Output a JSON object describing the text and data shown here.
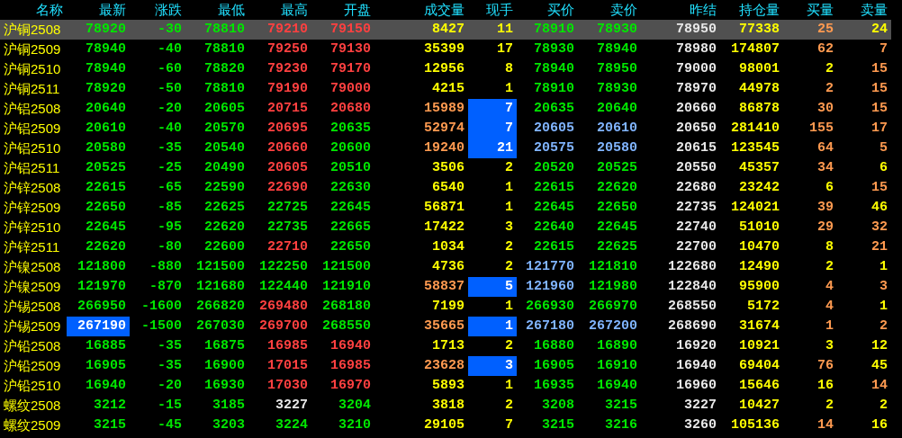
{
  "columns": [
    "名称",
    "最新",
    "涨跌",
    "最低",
    "最高",
    "开盘",
    "成交量",
    "现手",
    "买价",
    "卖价",
    "昨结",
    "持仓量",
    "买量",
    "卖量"
  ],
  "rows": [
    {
      "name": "沪铜2508",
      "selected": true,
      "cells": [
        {
          "text": "78920",
          "color": "#00e600",
          "highlighted": false
        },
        {
          "text": "-30",
          "color": "#00e600",
          "highlighted": false
        },
        {
          "text": "78810",
          "color": "#00e600",
          "highlighted": false
        },
        {
          "text": "79210",
          "color": "#ff4040",
          "highlighted": false
        },
        {
          "text": "79150",
          "color": "#ff4040",
          "highlighted": false
        },
        {
          "text": "8427",
          "color": "#ffff00",
          "highlighted": false
        },
        {
          "text": "11",
          "color": "#ffff00",
          "highlighted": false
        },
        {
          "text": "78910",
          "color": "#00e600",
          "highlighted": false
        },
        {
          "text": "78930",
          "color": "#00e600",
          "highlighted": false
        },
        {
          "text": "78950",
          "color": "#e8e8e8",
          "highlighted": false
        },
        {
          "text": "77338",
          "color": "#ffff00",
          "highlighted": false
        },
        {
          "text": "25",
          "color": "#ff9a50",
          "highlighted": false
        },
        {
          "text": "24",
          "color": "#ffff00",
          "highlighted": false
        }
      ]
    },
    {
      "name": "沪铜2509",
      "selected": false,
      "cells": [
        {
          "text": "78940",
          "color": "#00e600",
          "highlighted": false
        },
        {
          "text": "-40",
          "color": "#00e600",
          "highlighted": false
        },
        {
          "text": "78810",
          "color": "#00e600",
          "highlighted": false
        },
        {
          "text": "79250",
          "color": "#ff4040",
          "highlighted": false
        },
        {
          "text": "79130",
          "color": "#ff4040",
          "highlighted": false
        },
        {
          "text": "35399",
          "color": "#ffff00",
          "highlighted": false
        },
        {
          "text": "17",
          "color": "#ffff00",
          "highlighted": false
        },
        {
          "text": "78930",
          "color": "#00e600",
          "highlighted": false
        },
        {
          "text": "78940",
          "color": "#00e600",
          "highlighted": false
        },
        {
          "text": "78980",
          "color": "#e8e8e8",
          "highlighted": false
        },
        {
          "text": "174807",
          "color": "#ffff00",
          "highlighted": false
        },
        {
          "text": "62",
          "color": "#ff9a50",
          "highlighted": false
        },
        {
          "text": "7",
          "color": "#ff9a50",
          "highlighted": false
        }
      ]
    },
    {
      "name": "沪铜2510",
      "selected": false,
      "cells": [
        {
          "text": "78940",
          "color": "#00e600",
          "highlighted": false
        },
        {
          "text": "-60",
          "color": "#00e600",
          "highlighted": false
        },
        {
          "text": "78820",
          "color": "#00e600",
          "highlighted": false
        },
        {
          "text": "79230",
          "color": "#ff4040",
          "highlighted": false
        },
        {
          "text": "79170",
          "color": "#ff4040",
          "highlighted": false
        },
        {
          "text": "12956",
          "color": "#ffff00",
          "highlighted": false
        },
        {
          "text": "8",
          "color": "#ffff00",
          "highlighted": false
        },
        {
          "text": "78940",
          "color": "#00e600",
          "highlighted": false
        },
        {
          "text": "78950",
          "color": "#00e600",
          "highlighted": false
        },
        {
          "text": "79000",
          "color": "#e8e8e8",
          "highlighted": false
        },
        {
          "text": "98001",
          "color": "#ffff00",
          "highlighted": false
        },
        {
          "text": "2",
          "color": "#ffff00",
          "highlighted": false
        },
        {
          "text": "15",
          "color": "#ff9a50",
          "highlighted": false
        }
      ]
    },
    {
      "name": "沪铜2511",
      "selected": false,
      "cells": [
        {
          "text": "78920",
          "color": "#00e600",
          "highlighted": false
        },
        {
          "text": "-50",
          "color": "#00e600",
          "highlighted": false
        },
        {
          "text": "78810",
          "color": "#00e600",
          "highlighted": false
        },
        {
          "text": "79190",
          "color": "#ff4040",
          "highlighted": false
        },
        {
          "text": "79000",
          "color": "#ff4040",
          "highlighted": false
        },
        {
          "text": "4215",
          "color": "#ffff00",
          "highlighted": false
        },
        {
          "text": "1",
          "color": "#ffff00",
          "highlighted": false
        },
        {
          "text": "78910",
          "color": "#00e600",
          "highlighted": false
        },
        {
          "text": "78930",
          "color": "#00e600",
          "highlighted": false
        },
        {
          "text": "78970",
          "color": "#e8e8e8",
          "highlighted": false
        },
        {
          "text": "44978",
          "color": "#ffff00",
          "highlighted": false
        },
        {
          "text": "2",
          "color": "#ff9a50",
          "highlighted": false
        },
        {
          "text": "15",
          "color": "#ff9a50",
          "highlighted": false
        }
      ]
    },
    {
      "name": "沪铝2508",
      "selected": false,
      "cells": [
        {
          "text": "20640",
          "color": "#00e600",
          "highlighted": false
        },
        {
          "text": "-20",
          "color": "#00e600",
          "highlighted": false
        },
        {
          "text": "20605",
          "color": "#00e600",
          "highlighted": false
        },
        {
          "text": "20715",
          "color": "#ff4040",
          "highlighted": false
        },
        {
          "text": "20680",
          "color": "#ff4040",
          "highlighted": false
        },
        {
          "text": "15989",
          "color": "#ff9a50",
          "highlighted": false
        },
        {
          "text": "7",
          "color": "#ffffff",
          "highlighted": true
        },
        {
          "text": "20635",
          "color": "#00e600",
          "highlighted": false
        },
        {
          "text": "20640",
          "color": "#00e600",
          "highlighted": false
        },
        {
          "text": "20660",
          "color": "#e8e8e8",
          "highlighted": false
        },
        {
          "text": "86878",
          "color": "#ffff00",
          "highlighted": false
        },
        {
          "text": "30",
          "color": "#ff9a50",
          "highlighted": false
        },
        {
          "text": "15",
          "color": "#ff9a50",
          "highlighted": false
        }
      ]
    },
    {
      "name": "沪铝2509",
      "selected": false,
      "cells": [
        {
          "text": "20610",
          "color": "#00e600",
          "highlighted": false
        },
        {
          "text": "-40",
          "color": "#00e600",
          "highlighted": false
        },
        {
          "text": "20570",
          "color": "#00e600",
          "highlighted": false
        },
        {
          "text": "20695",
          "color": "#ff4040",
          "highlighted": false
        },
        {
          "text": "20635",
          "color": "#00e600",
          "highlighted": false
        },
        {
          "text": "52974",
          "color": "#ff9a50",
          "highlighted": false
        },
        {
          "text": "7",
          "color": "#ffffff",
          "highlighted": true
        },
        {
          "text": "20605",
          "color": "#80b4ff",
          "highlighted": false
        },
        {
          "text": "20610",
          "color": "#80b4ff",
          "highlighted": false
        },
        {
          "text": "20650",
          "color": "#e8e8e8",
          "highlighted": false
        },
        {
          "text": "281410",
          "color": "#ffff00",
          "highlighted": false
        },
        {
          "text": "155",
          "color": "#ff9a50",
          "highlighted": false
        },
        {
          "text": "17",
          "color": "#ff9a50",
          "highlighted": false
        }
      ]
    },
    {
      "name": "沪铝2510",
      "selected": false,
      "cells": [
        {
          "text": "20580",
          "color": "#00e600",
          "highlighted": false
        },
        {
          "text": "-35",
          "color": "#00e600",
          "highlighted": false
        },
        {
          "text": "20540",
          "color": "#00e600",
          "highlighted": false
        },
        {
          "text": "20660",
          "color": "#ff4040",
          "highlighted": false
        },
        {
          "text": "20600",
          "color": "#00e600",
          "highlighted": false
        },
        {
          "text": "19240",
          "color": "#ff9a50",
          "highlighted": false
        },
        {
          "text": "21",
          "color": "#ffffff",
          "highlighted": true
        },
        {
          "text": "20575",
          "color": "#80b4ff",
          "highlighted": false
        },
        {
          "text": "20580",
          "color": "#80b4ff",
          "highlighted": false
        },
        {
          "text": "20615",
          "color": "#e8e8e8",
          "highlighted": false
        },
        {
          "text": "123545",
          "color": "#ffff00",
          "highlighted": false
        },
        {
          "text": "64",
          "color": "#ff9a50",
          "highlighted": false
        },
        {
          "text": "5",
          "color": "#ff9a50",
          "highlighted": false
        }
      ]
    },
    {
      "name": "沪铝2511",
      "selected": false,
      "cells": [
        {
          "text": "20525",
          "color": "#00e600",
          "highlighted": false
        },
        {
          "text": "-25",
          "color": "#00e600",
          "highlighted": false
        },
        {
          "text": "20490",
          "color": "#00e600",
          "highlighted": false
        },
        {
          "text": "20605",
          "color": "#ff4040",
          "highlighted": false
        },
        {
          "text": "20510",
          "color": "#00e600",
          "highlighted": false
        },
        {
          "text": "3506",
          "color": "#ffff00",
          "highlighted": false
        },
        {
          "text": "2",
          "color": "#ffff00",
          "highlighted": false
        },
        {
          "text": "20520",
          "color": "#00e600",
          "highlighted": false
        },
        {
          "text": "20525",
          "color": "#00e600",
          "highlighted": false
        },
        {
          "text": "20550",
          "color": "#e8e8e8",
          "highlighted": false
        },
        {
          "text": "45357",
          "color": "#ffff00",
          "highlighted": false
        },
        {
          "text": "34",
          "color": "#ff9a50",
          "highlighted": false
        },
        {
          "text": "6",
          "color": "#ffff00",
          "highlighted": false
        }
      ]
    },
    {
      "name": "沪锌2508",
      "selected": false,
      "cells": [
        {
          "text": "22615",
          "color": "#00e600",
          "highlighted": false
        },
        {
          "text": "-65",
          "color": "#00e600",
          "highlighted": false
        },
        {
          "text": "22590",
          "color": "#00e600",
          "highlighted": false
        },
        {
          "text": "22690",
          "color": "#ff4040",
          "highlighted": false
        },
        {
          "text": "22630",
          "color": "#00e600",
          "highlighted": false
        },
        {
          "text": "6540",
          "color": "#ffff00",
          "highlighted": false
        },
        {
          "text": "1",
          "color": "#ffff00",
          "highlighted": false
        },
        {
          "text": "22615",
          "color": "#00e600",
          "highlighted": false
        },
        {
          "text": "22620",
          "color": "#00e600",
          "highlighted": false
        },
        {
          "text": "22680",
          "color": "#e8e8e8",
          "highlighted": false
        },
        {
          "text": "23242",
          "color": "#ffff00",
          "highlighted": false
        },
        {
          "text": "6",
          "color": "#ffff00",
          "highlighted": false
        },
        {
          "text": "15",
          "color": "#ff9a50",
          "highlighted": false
        }
      ]
    },
    {
      "name": "沪锌2509",
      "selected": false,
      "cells": [
        {
          "text": "22650",
          "color": "#00e600",
          "highlighted": false
        },
        {
          "text": "-85",
          "color": "#00e600",
          "highlighted": false
        },
        {
          "text": "22625",
          "color": "#00e600",
          "highlighted": false
        },
        {
          "text": "22725",
          "color": "#00e600",
          "highlighted": false
        },
        {
          "text": "22645",
          "color": "#00e600",
          "highlighted": false
        },
        {
          "text": "56871",
          "color": "#ffff00",
          "highlighted": false
        },
        {
          "text": "1",
          "color": "#ffff00",
          "highlighted": false
        },
        {
          "text": "22645",
          "color": "#00e600",
          "highlighted": false
        },
        {
          "text": "22650",
          "color": "#00e600",
          "highlighted": false
        },
        {
          "text": "22735",
          "color": "#e8e8e8",
          "highlighted": false
        },
        {
          "text": "124021",
          "color": "#ffff00",
          "highlighted": false
        },
        {
          "text": "39",
          "color": "#ff9a50",
          "highlighted": false
        },
        {
          "text": "46",
          "color": "#ffff00",
          "highlighted": false
        }
      ]
    },
    {
      "name": "沪锌2510",
      "selected": false,
      "cells": [
        {
          "text": "22645",
          "color": "#00e600",
          "highlighted": false
        },
        {
          "text": "-95",
          "color": "#00e600",
          "highlighted": false
        },
        {
          "text": "22620",
          "color": "#00e600",
          "highlighted": false
        },
        {
          "text": "22735",
          "color": "#00e600",
          "highlighted": false
        },
        {
          "text": "22665",
          "color": "#00e600",
          "highlighted": false
        },
        {
          "text": "17422",
          "color": "#ffff00",
          "highlighted": false
        },
        {
          "text": "3",
          "color": "#ffff00",
          "highlighted": false
        },
        {
          "text": "22640",
          "color": "#00e600",
          "highlighted": false
        },
        {
          "text": "22645",
          "color": "#00e600",
          "highlighted": false
        },
        {
          "text": "22740",
          "color": "#e8e8e8",
          "highlighted": false
        },
        {
          "text": "51010",
          "color": "#ffff00",
          "highlighted": false
        },
        {
          "text": "29",
          "color": "#ff9a50",
          "highlighted": false
        },
        {
          "text": "32",
          "color": "#ff9a50",
          "highlighted": false
        }
      ]
    },
    {
      "name": "沪锌2511",
      "selected": false,
      "cells": [
        {
          "text": "22620",
          "color": "#00e600",
          "highlighted": false
        },
        {
          "text": "-80",
          "color": "#00e600",
          "highlighted": false
        },
        {
          "text": "22600",
          "color": "#00e600",
          "highlighted": false
        },
        {
          "text": "22710",
          "color": "#ff4040",
          "highlighted": false
        },
        {
          "text": "22650",
          "color": "#00e600",
          "highlighted": false
        },
        {
          "text": "1034",
          "color": "#ffff00",
          "highlighted": false
        },
        {
          "text": "2",
          "color": "#ffff00",
          "highlighted": false
        },
        {
          "text": "22615",
          "color": "#00e600",
          "highlighted": false
        },
        {
          "text": "22625",
          "color": "#00e600",
          "highlighted": false
        },
        {
          "text": "22700",
          "color": "#e8e8e8",
          "highlighted": false
        },
        {
          "text": "10470",
          "color": "#ffff00",
          "highlighted": false
        },
        {
          "text": "8",
          "color": "#ffff00",
          "highlighted": false
        },
        {
          "text": "21",
          "color": "#ff9a50",
          "highlighted": false
        }
      ]
    },
    {
      "name": "沪镍2508",
      "selected": false,
      "cells": [
        {
          "text": "121800",
          "color": "#00e600",
          "highlighted": false
        },
        {
          "text": "-880",
          "color": "#00e600",
          "highlighted": false
        },
        {
          "text": "121500",
          "color": "#00e600",
          "highlighted": false
        },
        {
          "text": "122250",
          "color": "#00e600",
          "highlighted": false
        },
        {
          "text": "121500",
          "color": "#00e600",
          "highlighted": false
        },
        {
          "text": "4736",
          "color": "#ffff00",
          "highlighted": false
        },
        {
          "text": "2",
          "color": "#ffff00",
          "highlighted": false
        },
        {
          "text": "121770",
          "color": "#80b4ff",
          "highlighted": false
        },
        {
          "text": "121810",
          "color": "#00e600",
          "highlighted": false
        },
        {
          "text": "122680",
          "color": "#e8e8e8",
          "highlighted": false
        },
        {
          "text": "12490",
          "color": "#ffff00",
          "highlighted": false
        },
        {
          "text": "2",
          "color": "#ffff00",
          "highlighted": false
        },
        {
          "text": "1",
          "color": "#ffff00",
          "highlighted": false
        }
      ]
    },
    {
      "name": "沪镍2509",
      "selected": false,
      "cells": [
        {
          "text": "121970",
          "color": "#00e600",
          "highlighted": false
        },
        {
          "text": "-870",
          "color": "#00e600",
          "highlighted": false
        },
        {
          "text": "121680",
          "color": "#00e600",
          "highlighted": false
        },
        {
          "text": "122440",
          "color": "#00e600",
          "highlighted": false
        },
        {
          "text": "121910",
          "color": "#00e600",
          "highlighted": false
        },
        {
          "text": "58837",
          "color": "#ff9a50",
          "highlighted": false
        },
        {
          "text": "5",
          "color": "#ffffff",
          "highlighted": true
        },
        {
          "text": "121960",
          "color": "#80b4ff",
          "highlighted": false
        },
        {
          "text": "121980",
          "color": "#00e600",
          "highlighted": false
        },
        {
          "text": "122840",
          "color": "#e8e8e8",
          "highlighted": false
        },
        {
          "text": "95900",
          "color": "#ffff00",
          "highlighted": false
        },
        {
          "text": "4",
          "color": "#ff9a50",
          "highlighted": false
        },
        {
          "text": "3",
          "color": "#ff9a50",
          "highlighted": false
        }
      ]
    },
    {
      "name": "沪锡2508",
      "selected": false,
      "cells": [
        {
          "text": "266950",
          "color": "#00e600",
          "highlighted": false
        },
        {
          "text": "-1600",
          "color": "#00e600",
          "highlighted": false
        },
        {
          "text": "266820",
          "color": "#00e600",
          "highlighted": false
        },
        {
          "text": "269480",
          "color": "#ff4040",
          "highlighted": false
        },
        {
          "text": "268180",
          "color": "#00e600",
          "highlighted": false
        },
        {
          "text": "7199",
          "color": "#ffff00",
          "highlighted": false
        },
        {
          "text": "1",
          "color": "#ffff00",
          "highlighted": false
        },
        {
          "text": "266930",
          "color": "#00e600",
          "highlighted": false
        },
        {
          "text": "266970",
          "color": "#00e600",
          "highlighted": false
        },
        {
          "text": "268550",
          "color": "#e8e8e8",
          "highlighted": false
        },
        {
          "text": "5172",
          "color": "#ffff00",
          "highlighted": false
        },
        {
          "text": "4",
          "color": "#ff9a50",
          "highlighted": false
        },
        {
          "text": "1",
          "color": "#ffff00",
          "highlighted": false
        }
      ]
    },
    {
      "name": "沪锡2509",
      "selected": false,
      "cells": [
        {
          "text": "267190",
          "color": "#ffffff",
          "highlighted": true
        },
        {
          "text": "-1500",
          "color": "#00e600",
          "highlighted": false
        },
        {
          "text": "267030",
          "color": "#00e600",
          "highlighted": false
        },
        {
          "text": "269700",
          "color": "#ff4040",
          "highlighted": false
        },
        {
          "text": "268550",
          "color": "#00e600",
          "highlighted": false
        },
        {
          "text": "35665",
          "color": "#ff9a50",
          "highlighted": false
        },
        {
          "text": "1",
          "color": "#ffffff",
          "highlighted": true
        },
        {
          "text": "267180",
          "color": "#80b4ff",
          "highlighted": false
        },
        {
          "text": "267200",
          "color": "#80b4ff",
          "highlighted": false
        },
        {
          "text": "268690",
          "color": "#e8e8e8",
          "highlighted": false
        },
        {
          "text": "31674",
          "color": "#ffff00",
          "highlighted": false
        },
        {
          "text": "1",
          "color": "#ff9a50",
          "highlighted": false
        },
        {
          "text": "2",
          "color": "#ff9a50",
          "highlighted": false
        }
      ]
    },
    {
      "name": "沪铅2508",
      "selected": false,
      "cells": [
        {
          "text": "16885",
          "color": "#00e600",
          "highlighted": false
        },
        {
          "text": "-35",
          "color": "#00e600",
          "highlighted": false
        },
        {
          "text": "16875",
          "color": "#00e600",
          "highlighted": false
        },
        {
          "text": "16985",
          "color": "#ff4040",
          "highlighted": false
        },
        {
          "text": "16940",
          "color": "#ff4040",
          "highlighted": false
        },
        {
          "text": "1713",
          "color": "#ffff00",
          "highlighted": false
        },
        {
          "text": "2",
          "color": "#ffff00",
          "highlighted": false
        },
        {
          "text": "16880",
          "color": "#00e600",
          "highlighted": false
        },
        {
          "text": "16890",
          "color": "#00e600",
          "highlighted": false
        },
        {
          "text": "16920",
          "color": "#e8e8e8",
          "highlighted": false
        },
        {
          "text": "10921",
          "color": "#ffff00",
          "highlighted": false
        },
        {
          "text": "3",
          "color": "#ffff00",
          "highlighted": false
        },
        {
          "text": "12",
          "color": "#ffff00",
          "highlighted": false
        }
      ]
    },
    {
      "name": "沪铅2509",
      "selected": false,
      "cells": [
        {
          "text": "16905",
          "color": "#00e600",
          "highlighted": false
        },
        {
          "text": "-35",
          "color": "#00e600",
          "highlighted": false
        },
        {
          "text": "16900",
          "color": "#00e600",
          "highlighted": false
        },
        {
          "text": "17015",
          "color": "#ff4040",
          "highlighted": false
        },
        {
          "text": "16985",
          "color": "#ff4040",
          "highlighted": false
        },
        {
          "text": "23628",
          "color": "#ff9a50",
          "highlighted": false
        },
        {
          "text": "3",
          "color": "#ffffff",
          "highlighted": true
        },
        {
          "text": "16905",
          "color": "#00e600",
          "highlighted": false
        },
        {
          "text": "16910",
          "color": "#00e600",
          "highlighted": false
        },
        {
          "text": "16940",
          "color": "#e8e8e8",
          "highlighted": false
        },
        {
          "text": "69404",
          "color": "#ffff00",
          "highlighted": false
        },
        {
          "text": "76",
          "color": "#ff9a50",
          "highlighted": false
        },
        {
          "text": "45",
          "color": "#ffff00",
          "highlighted": false
        }
      ]
    },
    {
      "name": "沪铅2510",
      "selected": false,
      "cells": [
        {
          "text": "16940",
          "color": "#00e600",
          "highlighted": false
        },
        {
          "text": "-20",
          "color": "#00e600",
          "highlighted": false
        },
        {
          "text": "16930",
          "color": "#00e600",
          "highlighted": false
        },
        {
          "text": "17030",
          "color": "#ff4040",
          "highlighted": false
        },
        {
          "text": "16970",
          "color": "#ff4040",
          "highlighted": false
        },
        {
          "text": "5893",
          "color": "#ffff00",
          "highlighted": false
        },
        {
          "text": "1",
          "color": "#ffff00",
          "highlighted": false
        },
        {
          "text": "16935",
          "color": "#00e600",
          "highlighted": false
        },
        {
          "text": "16940",
          "color": "#00e600",
          "highlighted": false
        },
        {
          "text": "16960",
          "color": "#e8e8e8",
          "highlighted": false
        },
        {
          "text": "15646",
          "color": "#ffff00",
          "highlighted": false
        },
        {
          "text": "16",
          "color": "#ffff00",
          "highlighted": false
        },
        {
          "text": "14",
          "color": "#ff9a50",
          "highlighted": false
        }
      ]
    },
    {
      "name": "螺纹2508",
      "selected": false,
      "cells": [
        {
          "text": "3212",
          "color": "#00e600",
          "highlighted": false
        },
        {
          "text": "-15",
          "color": "#00e600",
          "highlighted": false
        },
        {
          "text": "3185",
          "color": "#00e600",
          "highlighted": false
        },
        {
          "text": "3227",
          "color": "#e8e8e8",
          "highlighted": false
        },
        {
          "text": "3204",
          "color": "#00e600",
          "highlighted": false
        },
        {
          "text": "3818",
          "color": "#ffff00",
          "highlighted": false
        },
        {
          "text": "2",
          "color": "#ffff00",
          "highlighted": false
        },
        {
          "text": "3208",
          "color": "#00e600",
          "highlighted": false
        },
        {
          "text": "3215",
          "color": "#00e600",
          "highlighted": false
        },
        {
          "text": "3227",
          "color": "#e8e8e8",
          "highlighted": false
        },
        {
          "text": "10427",
          "color": "#ffff00",
          "highlighted": false
        },
        {
          "text": "2",
          "color": "#ffff00",
          "highlighted": false
        },
        {
          "text": "2",
          "color": "#ffff00",
          "highlighted": false
        }
      ]
    },
    {
      "name": "螺纹2509",
      "selected": false,
      "cells": [
        {
          "text": "3215",
          "color": "#00e600",
          "highlighted": false
        },
        {
          "text": "-45",
          "color": "#00e600",
          "highlighted": false
        },
        {
          "text": "3203",
          "color": "#00e600",
          "highlighted": false
        },
        {
          "text": "3224",
          "color": "#00e600",
          "highlighted": false
        },
        {
          "text": "3210",
          "color": "#00e600",
          "highlighted": false
        },
        {
          "text": "29105",
          "color": "#ffff00",
          "highlighted": false
        },
        {
          "text": "7",
          "color": "#ffff00",
          "highlighted": false
        },
        {
          "text": "3215",
          "color": "#00e600",
          "highlighted": false
        },
        {
          "text": "3216",
          "color": "#00e600",
          "highlighted": false
        },
        {
          "text": "3260",
          "color": "#e8e8e8",
          "highlighted": false
        },
        {
          "text": "105136",
          "color": "#ffff00",
          "highlighted": false
        },
        {
          "text": "14",
          "color": "#ff9a50",
          "highlighted": false
        },
        {
          "text": "16",
          "color": "#ffff00",
          "highlighted": false
        }
      ]
    }
  ]
}
